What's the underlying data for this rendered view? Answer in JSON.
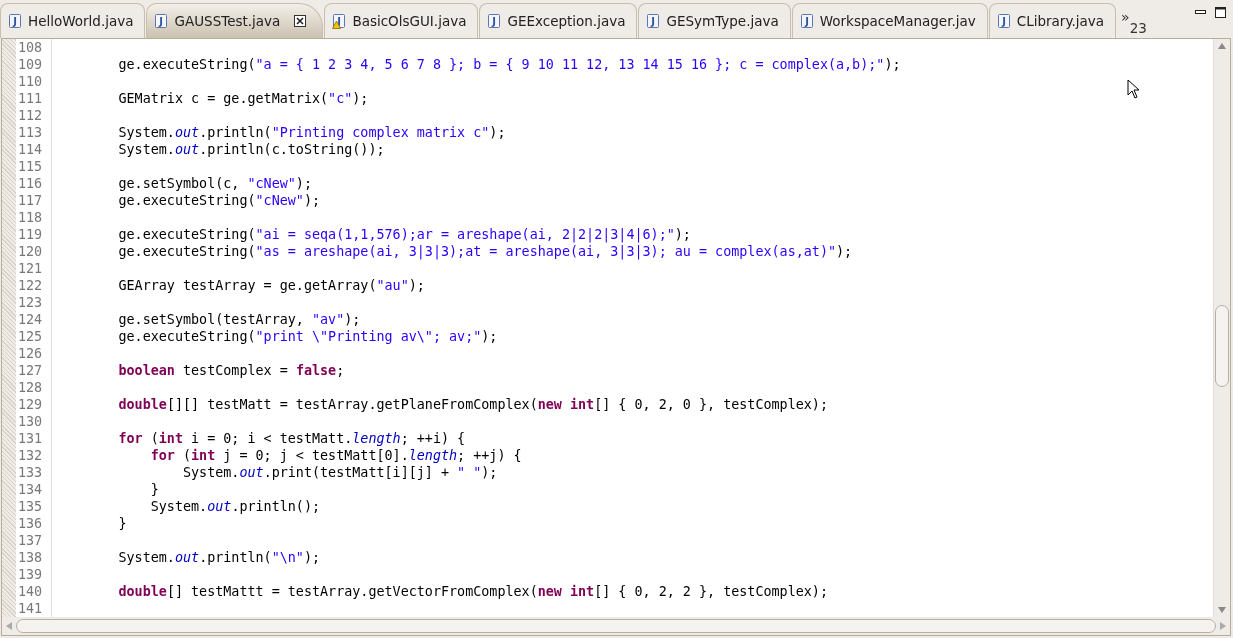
{
  "tabs": [
    {
      "label": "HelloWorld.java",
      "selected": false,
      "kind": "java",
      "icon_letter": "J"
    },
    {
      "label": "GAUSSTest.java",
      "selected": true,
      "kind": "java",
      "icon_letter": "J"
    },
    {
      "label": "BasicOlsGUI.java",
      "selected": false,
      "kind": "warning",
      "icon_letter": "J"
    },
    {
      "label": "GEException.java",
      "selected": false,
      "kind": "java",
      "icon_letter": "J"
    },
    {
      "label": "GESymType.java",
      "selected": false,
      "kind": "java",
      "icon_letter": "J"
    },
    {
      "label": "WorkspaceManager.jav",
      "selected": false,
      "kind": "java",
      "icon_letter": "J"
    },
    {
      "label": "CLibrary.java",
      "selected": false,
      "kind": "java",
      "icon_letter": "J"
    }
  ],
  "overflow": {
    "chevron": "»",
    "count": "23"
  },
  "editor": {
    "lines": [
      {
        "number": "108"
      },
      {
        "number": "109",
        "code": [
          {
            "kind": "plain",
            "text": "        ge.executeString("
          },
          {
            "kind": "string",
            "text": "\"a = { 1 2 3 4, 5 6 7 8 }; b = { 9 10 11 12, 13 14 15 16 }; c = complex(a,b);\""
          },
          {
            "kind": "plain",
            "text": ");"
          }
        ]
      },
      {
        "number": "110"
      },
      {
        "number": "111",
        "code": [
          {
            "kind": "plain",
            "text": "        GEMatrix c = ge.getMatrix("
          },
          {
            "kind": "string",
            "text": "\"c\""
          },
          {
            "kind": "plain",
            "text": ");"
          }
        ]
      },
      {
        "number": "112"
      },
      {
        "number": "113",
        "code": [
          {
            "kind": "plain",
            "text": "        System."
          },
          {
            "kind": "field",
            "text": "out"
          },
          {
            "kind": "plain",
            "text": ".println("
          },
          {
            "kind": "string",
            "text": "\"Printing complex matrix c\""
          },
          {
            "kind": "plain",
            "text": ");"
          }
        ]
      },
      {
        "number": "114",
        "code": [
          {
            "kind": "plain",
            "text": "        System."
          },
          {
            "kind": "field",
            "text": "out"
          },
          {
            "kind": "plain",
            "text": ".println(c.toString());"
          }
        ]
      },
      {
        "number": "115"
      },
      {
        "number": "116",
        "code": [
          {
            "kind": "plain",
            "text": "        ge.setSymbol(c, "
          },
          {
            "kind": "string",
            "text": "\"cNew\""
          },
          {
            "kind": "plain",
            "text": ");"
          }
        ]
      },
      {
        "number": "117",
        "code": [
          {
            "kind": "plain",
            "text": "        ge.executeString("
          },
          {
            "kind": "string",
            "text": "\"cNew\""
          },
          {
            "kind": "plain",
            "text": ");"
          }
        ]
      },
      {
        "number": "118"
      },
      {
        "number": "119",
        "code": [
          {
            "kind": "plain",
            "text": "        ge.executeString("
          },
          {
            "kind": "string",
            "text": "\"ai = seqa(1,1,576);ar = areshape(ai, 2|2|2|3|4|6);\""
          },
          {
            "kind": "plain",
            "text": ");"
          }
        ]
      },
      {
        "number": "120",
        "code": [
          {
            "kind": "plain",
            "text": "        ge.executeString("
          },
          {
            "kind": "string",
            "text": "\"as = areshape(ai, 3|3|3);at = areshape(ai, 3|3|3); au = complex(as,at)\""
          },
          {
            "kind": "plain",
            "text": ");"
          }
        ]
      },
      {
        "number": "121"
      },
      {
        "number": "122",
        "code": [
          {
            "kind": "plain",
            "text": "        GEArray testArray = ge.getArray("
          },
          {
            "kind": "string",
            "text": "\"au\""
          },
          {
            "kind": "plain",
            "text": ");"
          }
        ]
      },
      {
        "number": "123"
      },
      {
        "number": "124",
        "code": [
          {
            "kind": "plain",
            "text": "        ge.setSymbol(testArray, "
          },
          {
            "kind": "string",
            "text": "\"av\""
          },
          {
            "kind": "plain",
            "text": ");"
          }
        ]
      },
      {
        "number": "125",
        "code": [
          {
            "kind": "plain",
            "text": "        ge.executeString("
          },
          {
            "kind": "string",
            "text": "\"print \\\"Printing av\\\"; av;\""
          },
          {
            "kind": "plain",
            "text": ");"
          }
        ]
      },
      {
        "number": "126"
      },
      {
        "number": "127",
        "code": [
          {
            "kind": "keyword",
            "text": "        boolean"
          },
          {
            "kind": "plain",
            "text": " testComplex = "
          },
          {
            "kind": "keyword",
            "text": "false"
          },
          {
            "kind": "plain",
            "text": ";"
          }
        ]
      },
      {
        "number": "128"
      },
      {
        "number": "129",
        "code": [
          {
            "kind": "keyword",
            "text": "        double"
          },
          {
            "kind": "plain",
            "text": "[][] testMatt = testArray.getPlaneFromComplex("
          },
          {
            "kind": "keyword",
            "text": "new int"
          },
          {
            "kind": "plain",
            "text": "[] { 0, 2, 0 }, testComplex);"
          }
        ]
      },
      {
        "number": "130"
      },
      {
        "number": "131",
        "code": [
          {
            "kind": "keyword",
            "text": "        for"
          },
          {
            "kind": "plain",
            "text": " ("
          },
          {
            "kind": "keyword",
            "text": "int"
          },
          {
            "kind": "plain",
            "text": " i = 0; i < testMatt."
          },
          {
            "kind": "field",
            "text": "length"
          },
          {
            "kind": "plain",
            "text": "; ++i) {"
          }
        ]
      },
      {
        "number": "132",
        "code": [
          {
            "kind": "keyword",
            "text": "            for"
          },
          {
            "kind": "plain",
            "text": " ("
          },
          {
            "kind": "keyword",
            "text": "int"
          },
          {
            "kind": "plain",
            "text": " j = 0; j < testMatt[0]."
          },
          {
            "kind": "field",
            "text": "length"
          },
          {
            "kind": "plain",
            "text": "; ++j) {"
          }
        ]
      },
      {
        "number": "133",
        "code": [
          {
            "kind": "plain",
            "text": "                System."
          },
          {
            "kind": "field",
            "text": "out"
          },
          {
            "kind": "plain",
            "text": ".print(testMatt[i][j] + "
          },
          {
            "kind": "string",
            "text": "\" \""
          },
          {
            "kind": "plain",
            "text": ");"
          }
        ]
      },
      {
        "number": "134",
        "code": [
          {
            "kind": "plain",
            "text": "            }"
          }
        ]
      },
      {
        "number": "135",
        "code": [
          {
            "kind": "plain",
            "text": "            System."
          },
          {
            "kind": "field",
            "text": "out"
          },
          {
            "kind": "plain",
            "text": ".println();"
          }
        ]
      },
      {
        "number": "136",
        "code": [
          {
            "kind": "plain",
            "text": "        }"
          }
        ]
      },
      {
        "number": "137"
      },
      {
        "number": "138",
        "code": [
          {
            "kind": "plain",
            "text": "        System."
          },
          {
            "kind": "field",
            "text": "out"
          },
          {
            "kind": "plain",
            "text": ".println("
          },
          {
            "kind": "string",
            "text": "\"\\n\""
          },
          {
            "kind": "plain",
            "text": ");"
          }
        ]
      },
      {
        "number": "139"
      },
      {
        "number": "140",
        "code": [
          {
            "kind": "keyword",
            "text": "        double"
          },
          {
            "kind": "plain",
            "text": "[] testMattt = testArray.getVectorFromComplex("
          },
          {
            "kind": "keyword",
            "text": "new int"
          },
          {
            "kind": "plain",
            "text": "[] { 0, 2, 2 }, testComplex);"
          }
        ]
      },
      {
        "number": "141"
      }
    ]
  }
}
